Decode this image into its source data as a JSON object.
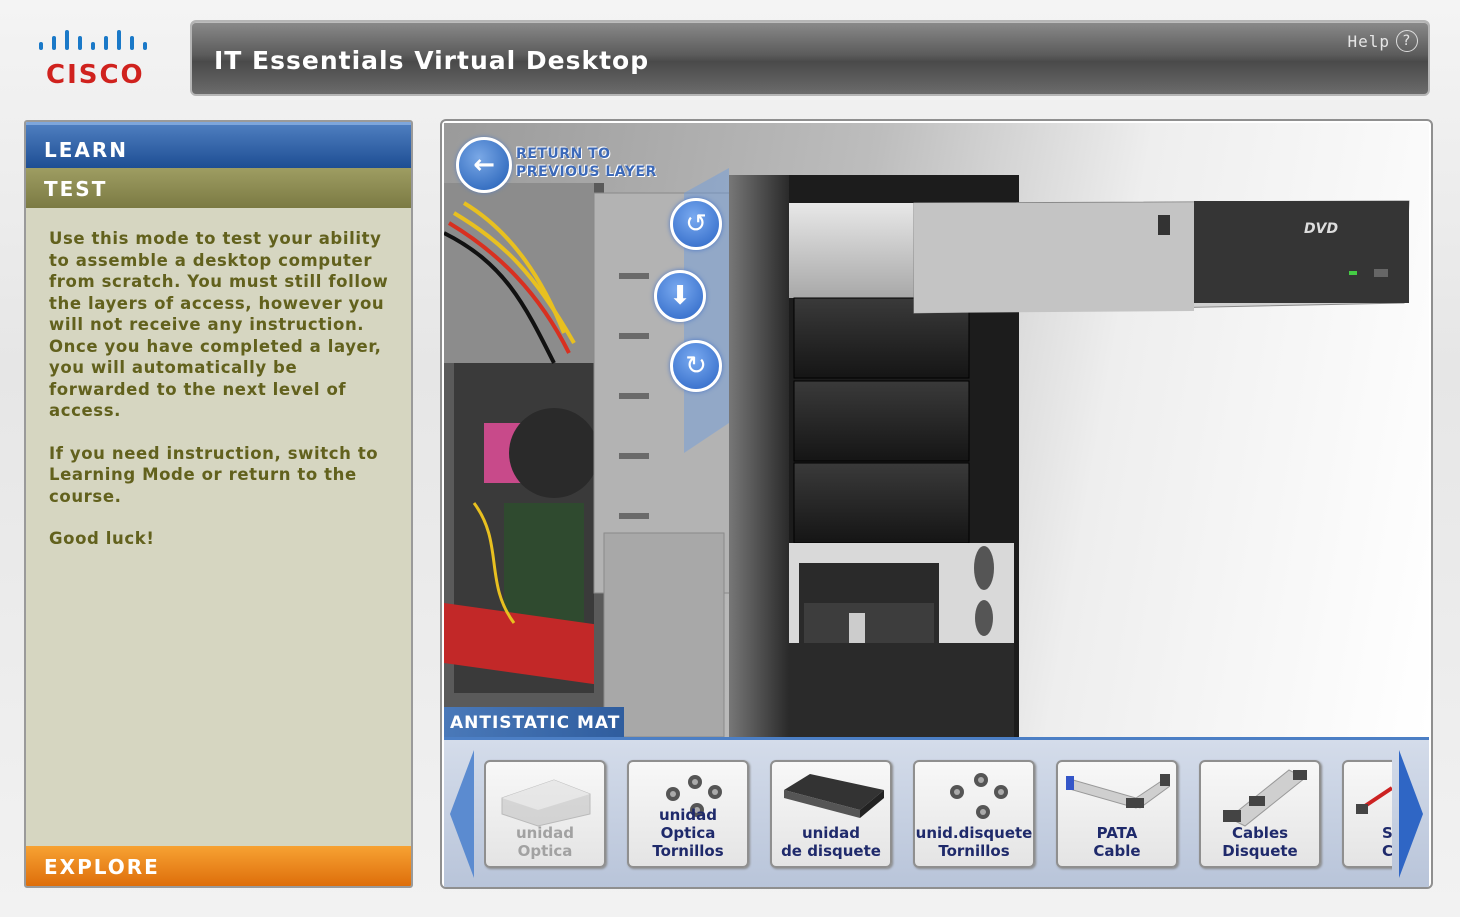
{
  "header": {
    "brand": "CISCO",
    "title": "IT Essentials Virtual Desktop",
    "help_label": "Help",
    "help_icon": "?"
  },
  "sidebar": {
    "learn_label": "LEARN",
    "test_label": "TEST",
    "explore_label": "EXPLORE",
    "description": [
      "Use this mode to test your ability to assemble a desktop computer from scratch. You must still follow the layers of access, however you will not receive any instruction. Once you have completed a layer, you will automatically be forwarded to the next level of access.",
      "If you need instruction, switch to Learning Mode or return to the course.",
      "Good luck!"
    ]
  },
  "scene": {
    "return_label_line1": "RETURN TO",
    "return_label_line2": "PREVIOUS LAYER",
    "antistatic_label": "ANTISTATIC MAT",
    "dvd_label": "DVD",
    "controls": [
      "rotate-ccw-icon",
      "download-icon",
      "rotate-cw-icon"
    ]
  },
  "tray": {
    "items": [
      {
        "line1": "unidad",
        "line2": "Optica",
        "disabled": true
      },
      {
        "line1": "unidad Optica",
        "line2": "Tornillos",
        "disabled": false
      },
      {
        "line1": "unidad",
        "line2": "de disquete",
        "disabled": false
      },
      {
        "line1": "unid.disquete",
        "line2": "Tornillos",
        "disabled": false
      },
      {
        "line1": "PATA",
        "line2": "Cable",
        "disabled": false
      },
      {
        "line1": "Cables",
        "line2": "Disquete",
        "disabled": false
      },
      {
        "line1": "S",
        "line2": "C",
        "disabled": false
      }
    ]
  },
  "colors": {
    "learn": "#1e4e93",
    "test": "#7b7a43",
    "explore": "#de6e0a",
    "panel_bg": "#d6d6c1",
    "desc_text": "#62611d",
    "accent_blue": "#2a64c4"
  }
}
